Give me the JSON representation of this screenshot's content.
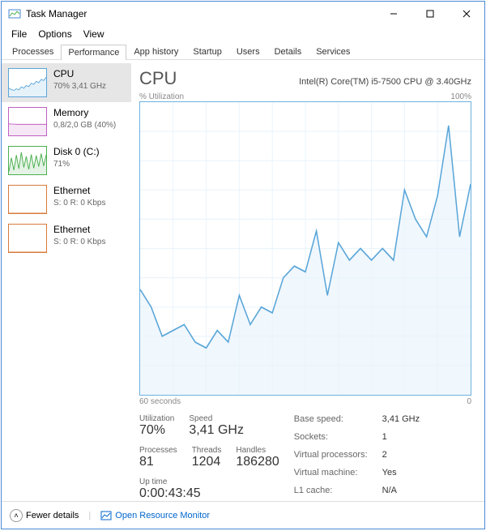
{
  "window": {
    "title": "Task Manager"
  },
  "menu": {
    "file": "File",
    "options": "Options",
    "view": "View"
  },
  "tabs": {
    "processes": "Processes",
    "performance": "Performance",
    "app_history": "App history",
    "startup": "Startup",
    "users": "Users",
    "details": "Details",
    "services": "Services"
  },
  "sidebar": {
    "items": [
      {
        "name": "CPU",
        "sub": "70% 3,41 GHz",
        "color": "#5aa6d8"
      },
      {
        "name": "Memory",
        "sub": "0,8/2,0 GB (40%)",
        "color": "#c060c0"
      },
      {
        "name": "Disk 0 (C:)",
        "sub": "71%",
        "color": "#4caf50"
      },
      {
        "name": "Ethernet",
        "sub": "S: 0  R: 0 Kbps",
        "color": "#d87a3a"
      },
      {
        "name": "Ethernet",
        "sub": "S: 0  R: 0 Kbps",
        "color": "#d87a3a"
      }
    ]
  },
  "main": {
    "heading": "CPU",
    "model": "Intel(R) Core(TM) i5-7500 CPU @ 3.40GHz",
    "ylabel": "% Utilization",
    "ymax": "100%",
    "xlabel_left": "60 seconds",
    "xlabel_right": "0"
  },
  "stats": {
    "utilization": {
      "label": "Utilization",
      "val": "70%"
    },
    "speed": {
      "label": "Speed",
      "val": "3,41 GHz"
    },
    "processes": {
      "label": "Processes",
      "val": "81"
    },
    "threads": {
      "label": "Threads",
      "val": "1204"
    },
    "handles": {
      "label": "Handles",
      "val": "186280"
    },
    "uptime": {
      "label": "Up time",
      "val": "0:00:43:45"
    }
  },
  "kv": {
    "base_speed_k": "Base speed:",
    "base_speed_v": "3,41 GHz",
    "sockets_k": "Sockets:",
    "sockets_v": "1",
    "vprocs_k": "Virtual processors:",
    "vprocs_v": "2",
    "vm_k": "Virtual machine:",
    "vm_v": "Yes",
    "l1_k": "L1 cache:",
    "l1_v": "N/A"
  },
  "footer": {
    "fewer": "Fewer details",
    "orm": "Open Resource Monitor"
  },
  "chart_data": {
    "type": "line",
    "title": "CPU % Utilization",
    "xlabel": "seconds",
    "ylabel": "% Utilization",
    "xlim": [
      60,
      0
    ],
    "ylim": [
      0,
      100
    ],
    "x": [
      60,
      58,
      56,
      54,
      52,
      50,
      48,
      46,
      44,
      42,
      40,
      38,
      36,
      34,
      32,
      30,
      28,
      26,
      24,
      22,
      20,
      18,
      16,
      14,
      12,
      10,
      8,
      6,
      4,
      2,
      0
    ],
    "values": [
      36,
      30,
      20,
      22,
      24,
      18,
      16,
      22,
      18,
      34,
      24,
      30,
      28,
      40,
      44,
      42,
      56,
      34,
      52,
      46,
      50,
      46,
      50,
      46,
      70,
      60,
      54,
      68,
      92,
      54,
      72
    ]
  },
  "mini_charts": {
    "cpu": {
      "type": "line",
      "ylim": [
        0,
        100
      ],
      "values": [
        30,
        25,
        22,
        28,
        24,
        35,
        30,
        40,
        36,
        48,
        44,
        55,
        50,
        62,
        58,
        70
      ]
    },
    "memory": {
      "type": "line",
      "ylim": [
        0,
        100
      ],
      "values": [
        42,
        41,
        41,
        40,
        40,
        40,
        40,
        40,
        40,
        40,
        40,
        40,
        40,
        40,
        40,
        40
      ]
    },
    "disk": {
      "type": "line",
      "ylim": [
        0,
        100
      ],
      "values": [
        10,
        60,
        15,
        70,
        20,
        80,
        25,
        65,
        18,
        72,
        22,
        68,
        28,
        75,
        30,
        71
      ]
    },
    "eth0": {
      "type": "line",
      "ylim": [
        0,
        100
      ],
      "values": [
        0,
        0,
        0,
        0,
        0,
        0,
        0,
        0,
        0,
        0,
        0,
        0,
        0,
        0,
        0,
        0
      ]
    },
    "eth1": {
      "type": "line",
      "ylim": [
        0,
        100
      ],
      "values": [
        0,
        0,
        0,
        0,
        0,
        0,
        0,
        0,
        0,
        0,
        0,
        0,
        0,
        0,
        0,
        0
      ]
    }
  }
}
